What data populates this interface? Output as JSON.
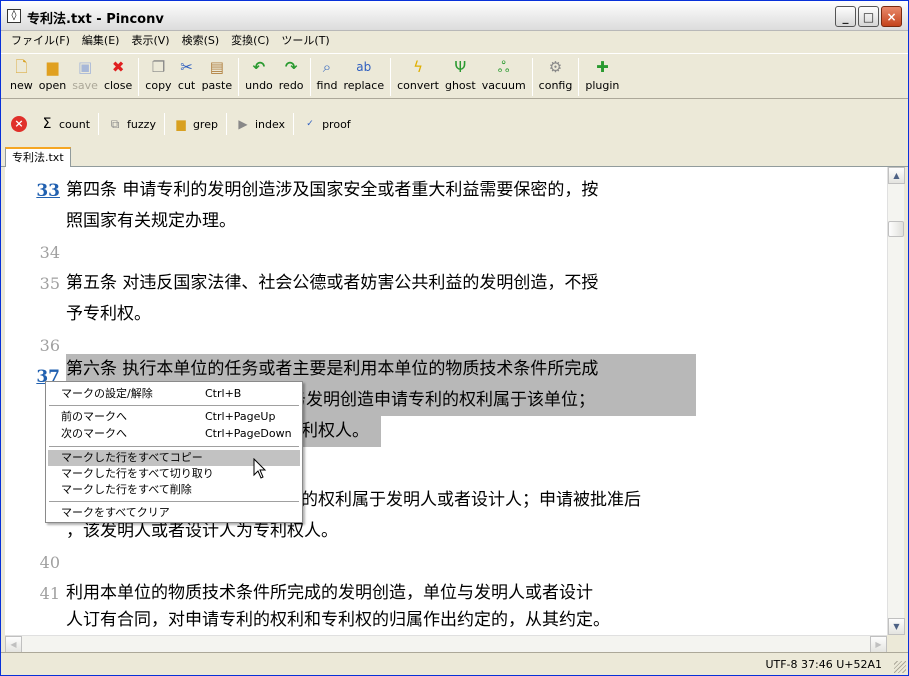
{
  "window": {
    "title": "专利法.txt - Pinconv",
    "controls": {
      "minimize": "_",
      "maximize": "□",
      "close": "×"
    }
  },
  "menu": [
    "ファイル(F)",
    "編集(E)",
    "表示(V)",
    "検索(S)",
    "変換(C)",
    "ツール(T)"
  ],
  "toolbar": {
    "new": "new",
    "open": "open",
    "save": "save",
    "close": "close",
    "copy": "copy",
    "cut": "cut",
    "paste": "paste",
    "undo": "undo",
    "redo": "redo",
    "find": "find",
    "replace": "replace",
    "convert": "convert",
    "ghost": "ghost",
    "vacuum": "vacuum",
    "config": "config",
    "plugin": "plugin"
  },
  "toolbar2": {
    "count": "count",
    "fuzzy": "fuzzy",
    "grep": "grep",
    "index": "index",
    "proof": "proof"
  },
  "tab": {
    "label": "专利法.txt"
  },
  "editor": {
    "lines": [
      {
        "num": "33",
        "text": "第四条 申请专利的发明创造涉及国家安全或者重大利益需要保密的，按"
      },
      {
        "num": "",
        "text": "照国家有关规定办理。"
      },
      {
        "num": "34",
        "text": ""
      },
      {
        "num": "35",
        "text": "第五条 对违反国家法律、社会公德或者妨害公共利益的发明创造，不授"
      },
      {
        "num": "",
        "text": "予专利权。"
      },
      {
        "num": "36",
        "text": ""
      },
      {
        "num": "37",
        "text": "第六条 执行本单位的任务或者主要是利用本单位的物质技术条件所完成"
      },
      {
        "num": "",
        "text": "，职务发明创造申请专利的权利属于该单位；"
      },
      {
        "num": "",
        "text": "利权人。"
      },
      {
        "num": "",
        "text": ""
      },
      {
        "num": "3",
        "text": "的权利属于发明人或者设计人；申请被批准后"
      },
      {
        "num": "",
        "text": "，该发明人或者设计人为专利权人。"
      },
      {
        "num": "40",
        "text": ""
      },
      {
        "num": "41",
        "text": "利用本单位的物质技术条件所完成的发明创造，单位与发明人或者设计"
      },
      {
        "num": "",
        "text": "人订有合同，对申请专利的权利和专利权的归属作出约定的，从其约定。"
      }
    ]
  },
  "context_menu": {
    "items": [
      {
        "label": "マークの設定/解除",
        "accel": "Ctrl+B"
      },
      {
        "label": "前のマークへ",
        "accel": "Ctrl+PageUp"
      },
      {
        "label": "次のマークへ",
        "accel": "Ctrl+PageDown"
      },
      {
        "label": "マークした行をすべてコピー",
        "accel": ""
      },
      {
        "label": "マークした行をすべて切り取り",
        "accel": ""
      },
      {
        "label": "マークした行をすべて削除",
        "accel": ""
      },
      {
        "label": "マークをすべてクリア",
        "accel": ""
      }
    ]
  },
  "status": {
    "text": "UTF-8  37:46  U+52A1"
  },
  "colors": {
    "title_bar": "#f0f0f0",
    "selection": "#b8b8b8",
    "mark_line_number": "#2060b0",
    "close_button": "#c4431c"
  }
}
